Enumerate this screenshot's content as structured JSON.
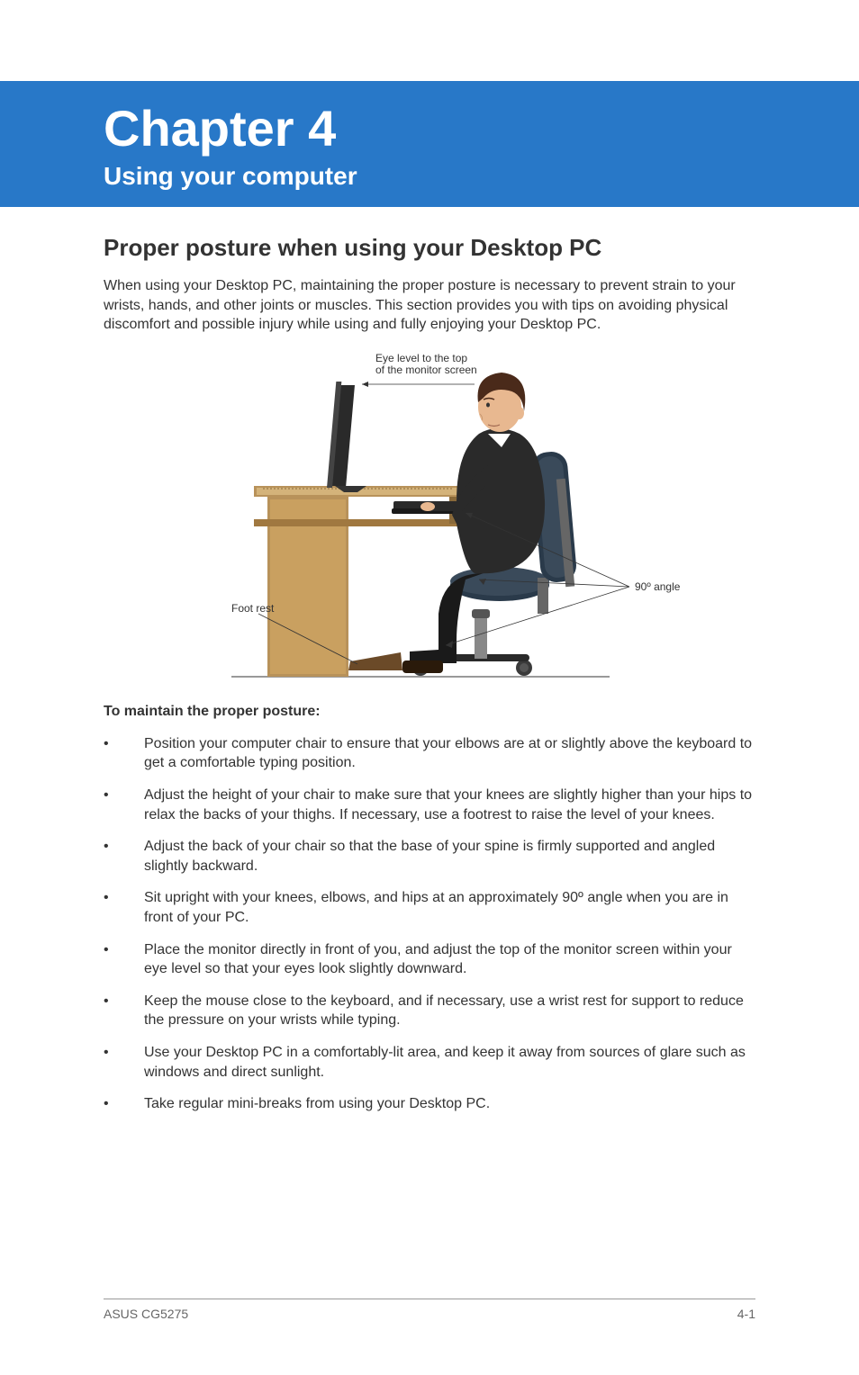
{
  "banner": {
    "chapter": "Chapter 4",
    "subtitle": "Using your computer"
  },
  "section": {
    "heading": "Proper posture when using your Desktop PC",
    "intro": "When using your Desktop PC, maintaining the proper posture is necessary to prevent strain to your wrists, hands, and other joints or muscles. This section provides you with tips on avoiding physical discomfort and possible injury while using and fully enjoying your Desktop PC.",
    "figure": {
      "eye_level": "Eye level to the top of the monitor screen",
      "foot_rest": "Foot rest",
      "angle": "90º angle"
    },
    "sub_heading": "To maintain the proper posture:",
    "tips": [
      "Position your computer chair to ensure that your elbows are at or slightly above the keyboard to get a comfortable typing position.",
      "Adjust the height of your chair to make sure that your knees are slightly higher than your hips to relax the backs of your thighs. If necessary, use a footrest to raise the level of your knees.",
      "Adjust the back of your chair so that the base of your spine is firmly supported and angled slightly backward.",
      "Sit upright with your knees, elbows, and hips at an approximately 90º angle when you are in front of your PC.",
      "Place the monitor directly in front of you, and adjust the top of the monitor screen within your eye level so that your eyes look slightly downward.",
      "Keep the mouse close to the keyboard, and if necessary, use a wrist rest for support to reduce the pressure on your wrists while typing.",
      "Use your Desktop PC in a comfortably-lit area, and keep it away from sources of glare such as windows and direct sunlight.",
      "Take regular mini-breaks from using your Desktop PC."
    ]
  },
  "footer": {
    "left": "ASUS CG5275",
    "right": "4-1"
  }
}
